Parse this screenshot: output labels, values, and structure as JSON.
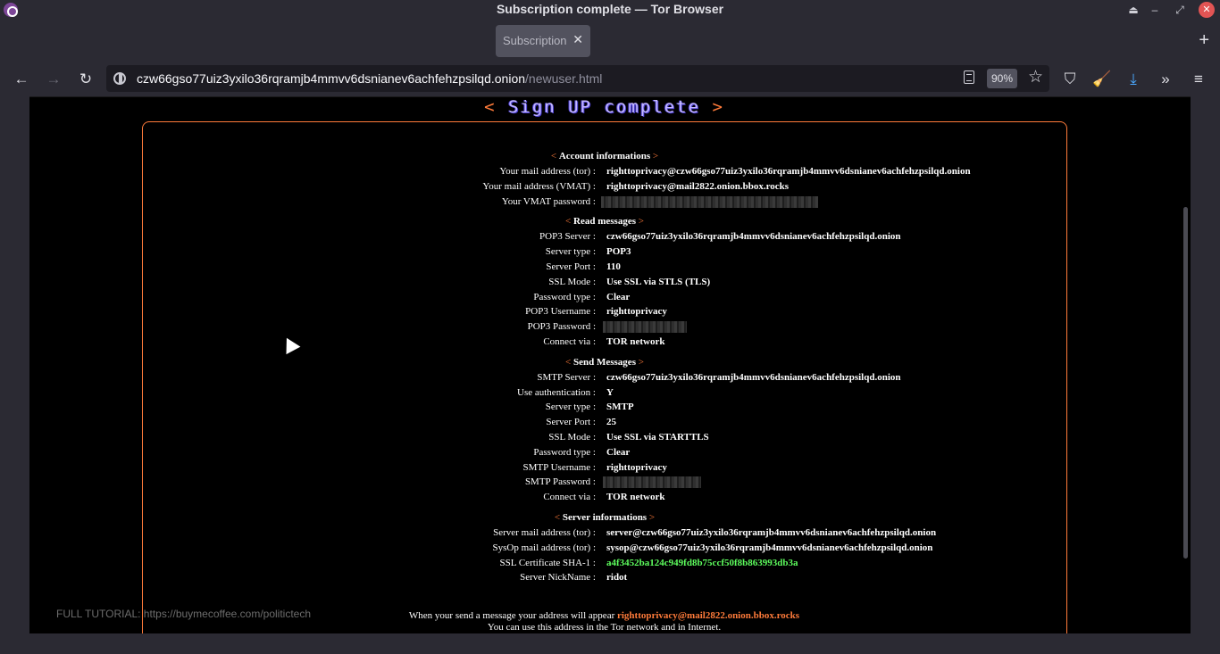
{
  "window": {
    "title": "Subscription complete — Tor Browser",
    "app_icon": "tor-browser-icon",
    "controls": [
      "minimize-icon",
      "maximize-icon",
      "close-icon"
    ]
  },
  "tabs": [
    {
      "label": "Subscription complete",
      "active": true
    }
  ],
  "navbar": {
    "url_host": "czw66gso77uiz3yxilo36rqramjb4mmvv6dsnianev6achfehzpsilqd.onion",
    "url_path": "/newuser.html",
    "zoom": "90%"
  },
  "page": {
    "heading_open": "<",
    "heading_text": "Sign UP complete",
    "heading_close": ">",
    "sections": {
      "account": {
        "title": "Account informations",
        "rows": [
          {
            "label": "Your mail address (tor) :",
            "value": "righttoprivacy@czw66gso77uiz3yxilo36rqramjb4mmvv6dsnianev6achfehzpsilqd.onion"
          },
          {
            "label": "Your mail address (VMAT) :",
            "value": "righttoprivacy@mail2822.onion.bbox.rocks"
          },
          {
            "label": "Your VMAT password :",
            "value": ""
          }
        ]
      },
      "read": {
        "title": "Read messages",
        "rows": [
          {
            "label": "POP3 Server :",
            "value": "czw66gso77uiz3yxilo36rqramjb4mmvv6dsnianev6achfehzpsilqd.onion"
          },
          {
            "label": "Server type :",
            "value": "POP3"
          },
          {
            "label": "Server Port :",
            "value": "110"
          },
          {
            "label": "SSL Mode :",
            "value": "Use SSL via STLS (TLS)"
          },
          {
            "label": "Password type :",
            "value": "Clear"
          },
          {
            "label": "POP3 Username :",
            "value": "righttoprivacy"
          },
          {
            "label": "POP3 Password :",
            "value": ""
          },
          {
            "label": "Connect via :",
            "value": "TOR network"
          }
        ]
      },
      "send": {
        "title": "Send Messages",
        "rows": [
          {
            "label": "SMTP Server :",
            "value": "czw66gso77uiz3yxilo36rqramjb4mmvv6dsnianev6achfehzpsilqd.onion"
          },
          {
            "label": "Use authentication :",
            "value": "Y"
          },
          {
            "label": "Server type :",
            "value": "SMTP"
          },
          {
            "label": "Server Port :",
            "value": "25"
          },
          {
            "label": "SSL Mode :",
            "value": "Use SSL via STARTTLS"
          },
          {
            "label": "Password type :",
            "value": "Clear"
          },
          {
            "label": "SMTP Username :",
            "value": "righttoprivacy"
          },
          {
            "label": "SMTP Password :",
            "value": ""
          },
          {
            "label": "Connect via :",
            "value": "TOR network"
          }
        ]
      },
      "server": {
        "title": "Server informations",
        "rows": [
          {
            "label": "Server mail address (tor) :",
            "value": "server@czw66gso77uiz3yxilo36rqramjb4mmvv6dsnianev6achfehzpsilqd.onion"
          },
          {
            "label": "SysOp mail address (tor) :",
            "value": "sysop@czw66gso77uiz3yxilo36rqramjb4mmvv6dsnianev6achfehzpsilqd.onion"
          },
          {
            "label": "SSL Certificate SHA-1 :",
            "value": "a4f3452ba124c949fd8b75ccf50f8b863993db3a"
          },
          {
            "label": "Server NickName :",
            "value": "ridot"
          }
        ]
      }
    },
    "footer_prefix": "When your send a message your address will appear",
    "footer_address": "righttoprivacy@mail2822.onion.bbox.rocks",
    "footer_line2": "You can use this address in the Tor network and in Internet.",
    "overlay_text": "FULL TUTORIAL: https://buymecoffee.com/politictech"
  },
  "colors": {
    "chrome_bg": "#2b2a33",
    "accent_orange": "#ff7b3a",
    "cert_green": "#5dfc5d"
  }
}
